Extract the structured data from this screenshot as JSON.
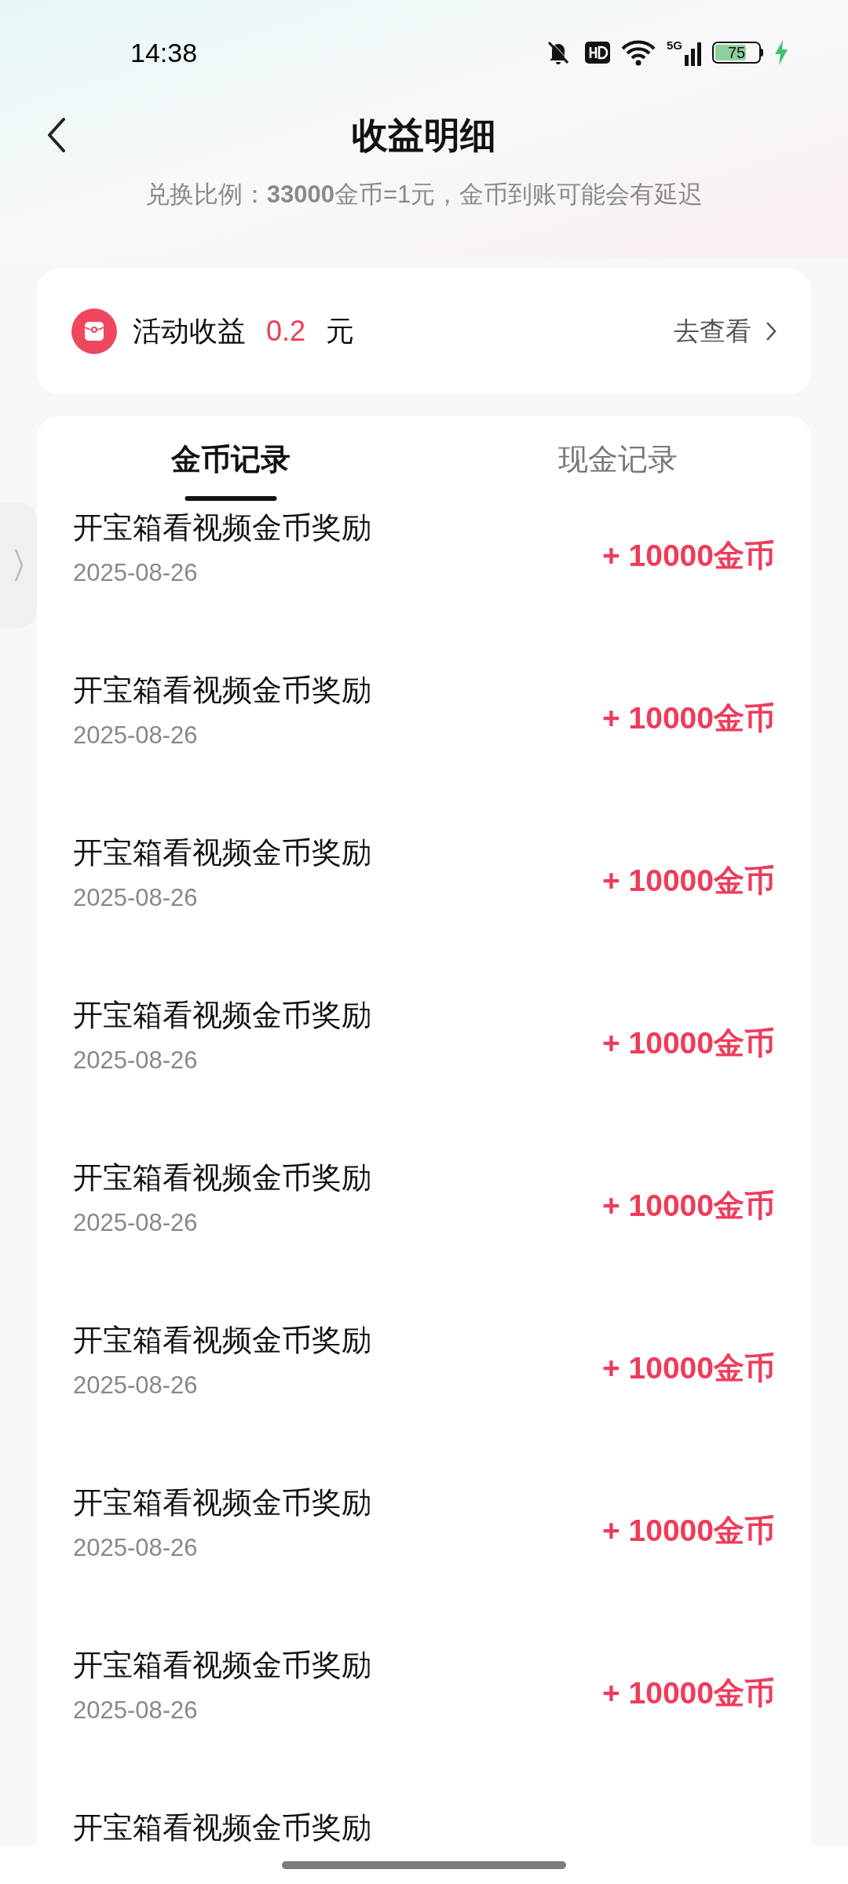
{
  "status_bar": {
    "time": "14:38",
    "battery": "75",
    "network": "5G"
  },
  "header": {
    "title": "收益明细",
    "subtitle": "兑换比例：**33000**金币=1元，金币到账可能会有延迟"
  },
  "activity_card": {
    "label": "活动收益",
    "amount": "0.2",
    "unit": "元",
    "link": "去查看"
  },
  "tabs": [
    {
      "label": "金币记录",
      "selected": true
    },
    {
      "label": "现金记录",
      "selected": false
    }
  ],
  "records": [
    {
      "title": "开宝箱看视频金币奖励",
      "date": "2025-08-26",
      "amount": "+ 10000金币"
    },
    {
      "title": "开宝箱看视频金币奖励",
      "date": "2025-08-26",
      "amount": "+ 10000金币"
    },
    {
      "title": "开宝箱看视频金币奖励",
      "date": "2025-08-26",
      "amount": "+ 10000金币"
    },
    {
      "title": "开宝箱看视频金币奖励",
      "date": "2025-08-26",
      "amount": "+ 10000金币"
    },
    {
      "title": "开宝箱看视频金币奖励",
      "date": "2025-08-26",
      "amount": "+ 10000金币"
    },
    {
      "title": "开宝箱看视频金币奖励",
      "date": "2025-08-26",
      "amount": "+ 10000金币"
    },
    {
      "title": "开宝箱看视频金币奖励",
      "date": "2025-08-26",
      "amount": "+ 10000金币"
    },
    {
      "title": "开宝箱看视频金币奖励",
      "date": "2025-08-26",
      "amount": "+ 10000金币"
    },
    {
      "title": "开宝箱看视频金币奖励"
    }
  ]
}
